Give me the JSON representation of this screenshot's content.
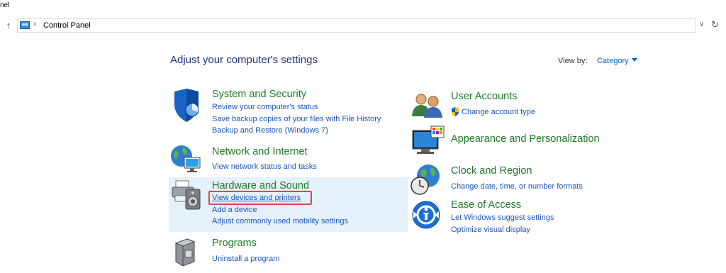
{
  "window": {
    "title_fragment": "nel"
  },
  "address_bar": {
    "crumb": "Control Panel",
    "separator": "›"
  },
  "header": {
    "title": "Adjust your computer's settings",
    "view_by_label": "View by:",
    "view_by_value": "Category"
  },
  "categories_left": [
    {
      "title": "System and Security",
      "links": [
        "Review your computer's status",
        "Save backup copies of your files with File History",
        "Backup and Restore (Windows 7)"
      ],
      "icon": "shield-icon"
    },
    {
      "title": "Network and Internet",
      "links": [
        "View network status and tasks"
      ],
      "icon": "network-globe-icon"
    },
    {
      "title": "Hardware and Sound",
      "links": [
        "View devices and printers",
        "Add a device",
        "Adjust commonly used mobility settings"
      ],
      "icon": "printer-speaker-icon",
      "highlighted": true
    },
    {
      "title": "Programs",
      "links": [
        "Uninstall a program"
      ],
      "icon": "programs-box-icon"
    }
  ],
  "categories_right": [
    {
      "title": "User Accounts",
      "links": [
        "Change account type"
      ],
      "icon": "users-icon",
      "link_icon": "uac-shield-icon"
    },
    {
      "title": "Appearance and Personalization",
      "links": [],
      "icon": "monitor-palette-icon"
    },
    {
      "title": "Clock and Region",
      "links": [
        "Change date, time, or number formats"
      ],
      "icon": "clock-globe-icon"
    },
    {
      "title": "Ease of Access",
      "links": [
        "Let Windows suggest settings",
        "Optimize visual display"
      ],
      "icon": "ease-of-access-icon"
    }
  ],
  "colors": {
    "title_blue": "#1e3287",
    "category_green": "#1f7a26",
    "link_blue": "#1a56b8",
    "highlight": "#e5f1fb",
    "selection_red": "#e04646"
  }
}
